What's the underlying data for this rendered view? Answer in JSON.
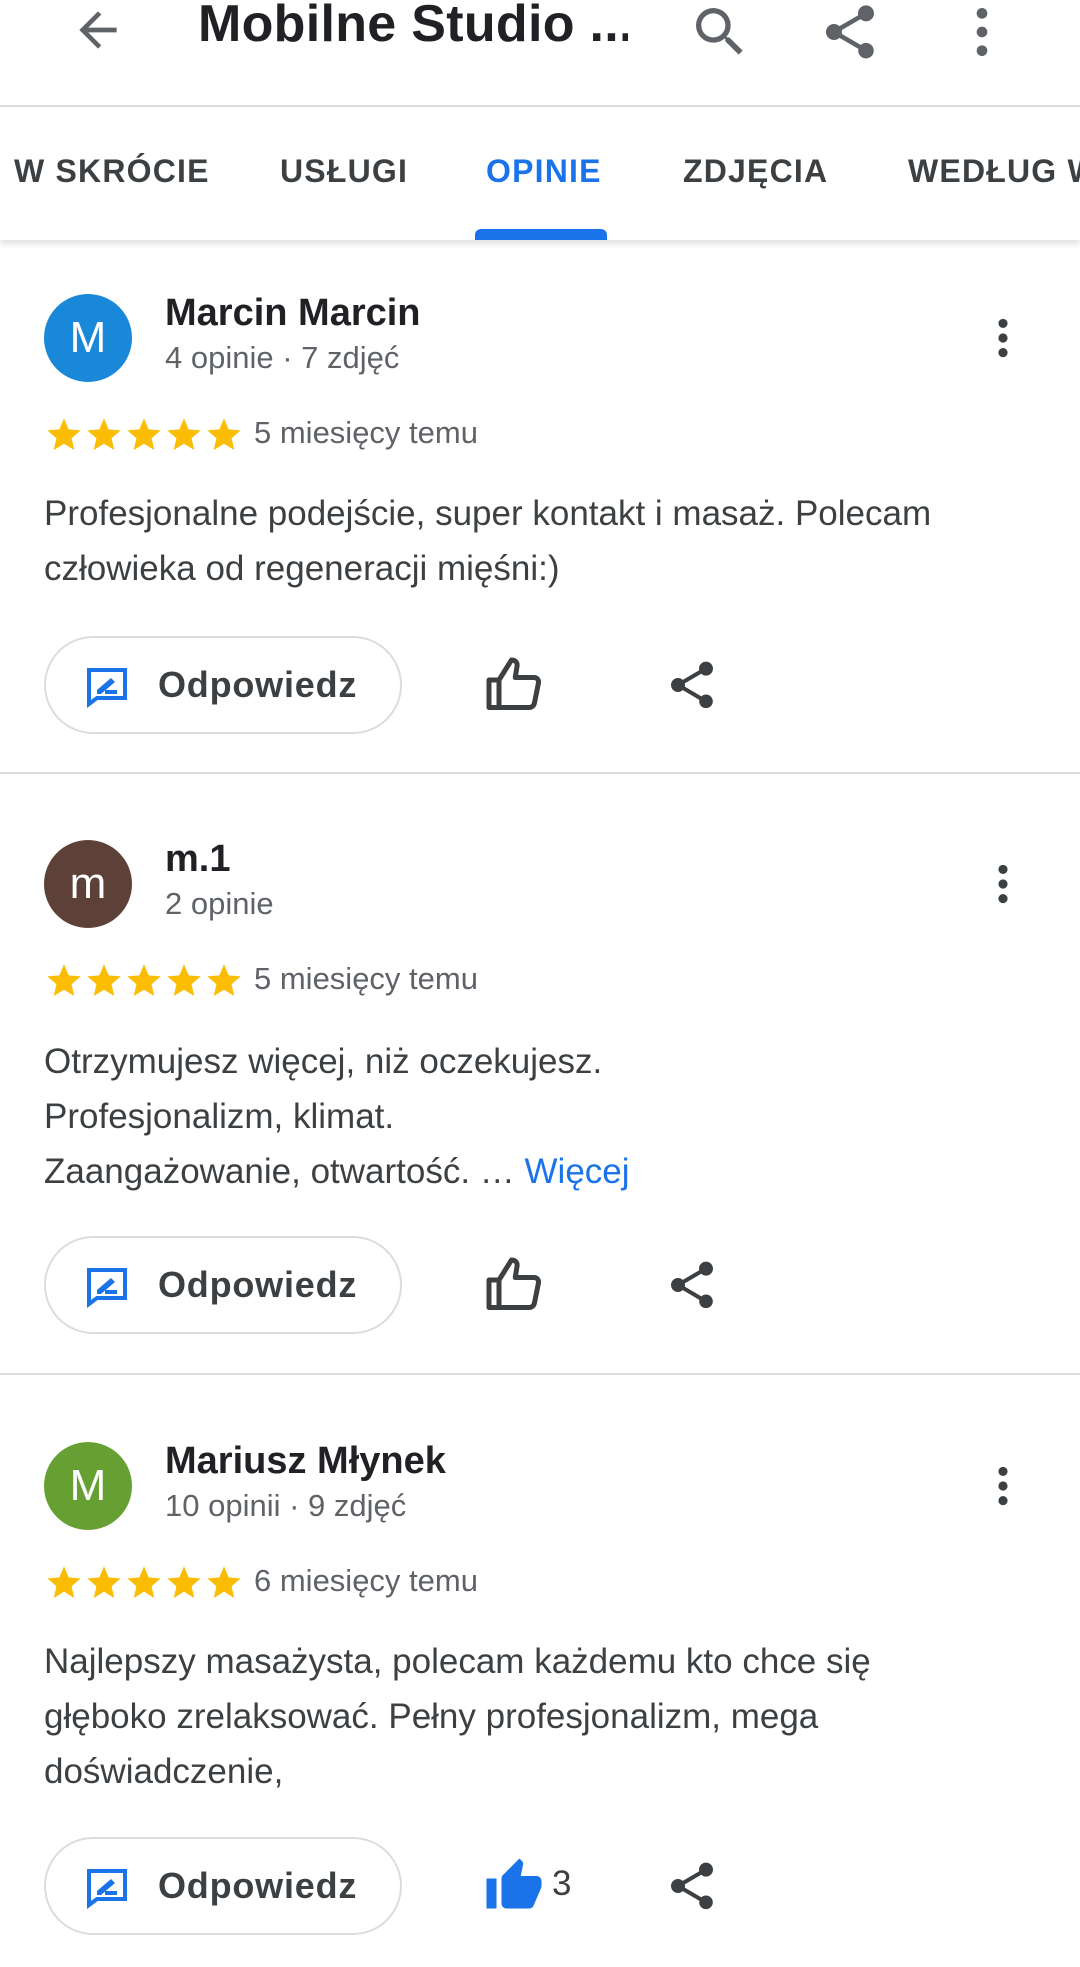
{
  "app_bar": {
    "title": "Mobilne Studio ...",
    "icons": [
      "back-arrow-icon",
      "search-icon",
      "share-icon",
      "more-vert-icon"
    ]
  },
  "tabs": [
    {
      "label": "W SKRÓCIE",
      "active": false
    },
    {
      "label": "USŁUGI",
      "active": false
    },
    {
      "label": "OPINIE",
      "active": true
    },
    {
      "label": "ZDJĘCIA",
      "active": false
    },
    {
      "label": "WEDŁUG W",
      "active": false
    }
  ],
  "colors": {
    "accent": "#1a73e8",
    "star": "#fbbc04",
    "text_primary": "#202124",
    "text_secondary": "#5f6368"
  },
  "reviews": [
    {
      "avatar_letter": "M",
      "avatar_color": "#1a88d9",
      "name": "Marcin Marcin",
      "meta": "4 opinie · 7 zdjęć",
      "rating": 5,
      "date": "5 miesięcy temu",
      "text_lines": [
        "Profesjonalne podejście, super kontakt i masaż. Polecam",
        "człowieka od regeneracji mięśni:)"
      ],
      "reply_label": "Odpowiedz",
      "likes": "",
      "liked": false
    },
    {
      "avatar_letter": "m",
      "avatar_color": "#5d4037",
      "name": "m.1",
      "meta": "2 opinie",
      "rating": 5,
      "date": "5 miesięcy temu",
      "text_lines": [
        "Otrzymujesz więcej, niż oczekujesz.",
        "Profesjonalizm, klimat.",
        "Zaangażowanie, otwartość. … "
      ],
      "more_label": "Więcej",
      "reply_label": "Odpowiedz",
      "likes": "",
      "liked": false
    },
    {
      "avatar_letter": "M",
      "avatar_color": "#66a033",
      "name": "Mariusz Młynek",
      "meta": "10 opinii · 9 zdjęć",
      "rating": 5,
      "date": "6 miesięcy temu",
      "text_lines": [
        "Najlepszy masażysta, polecam każdemu kto chce się",
        "głęboko zrelaksować. Pełny profesjonalizm, mega",
        "doświadczenie,"
      ],
      "reply_label": "Odpowiedz",
      "likes": "3",
      "liked": true
    }
  ]
}
